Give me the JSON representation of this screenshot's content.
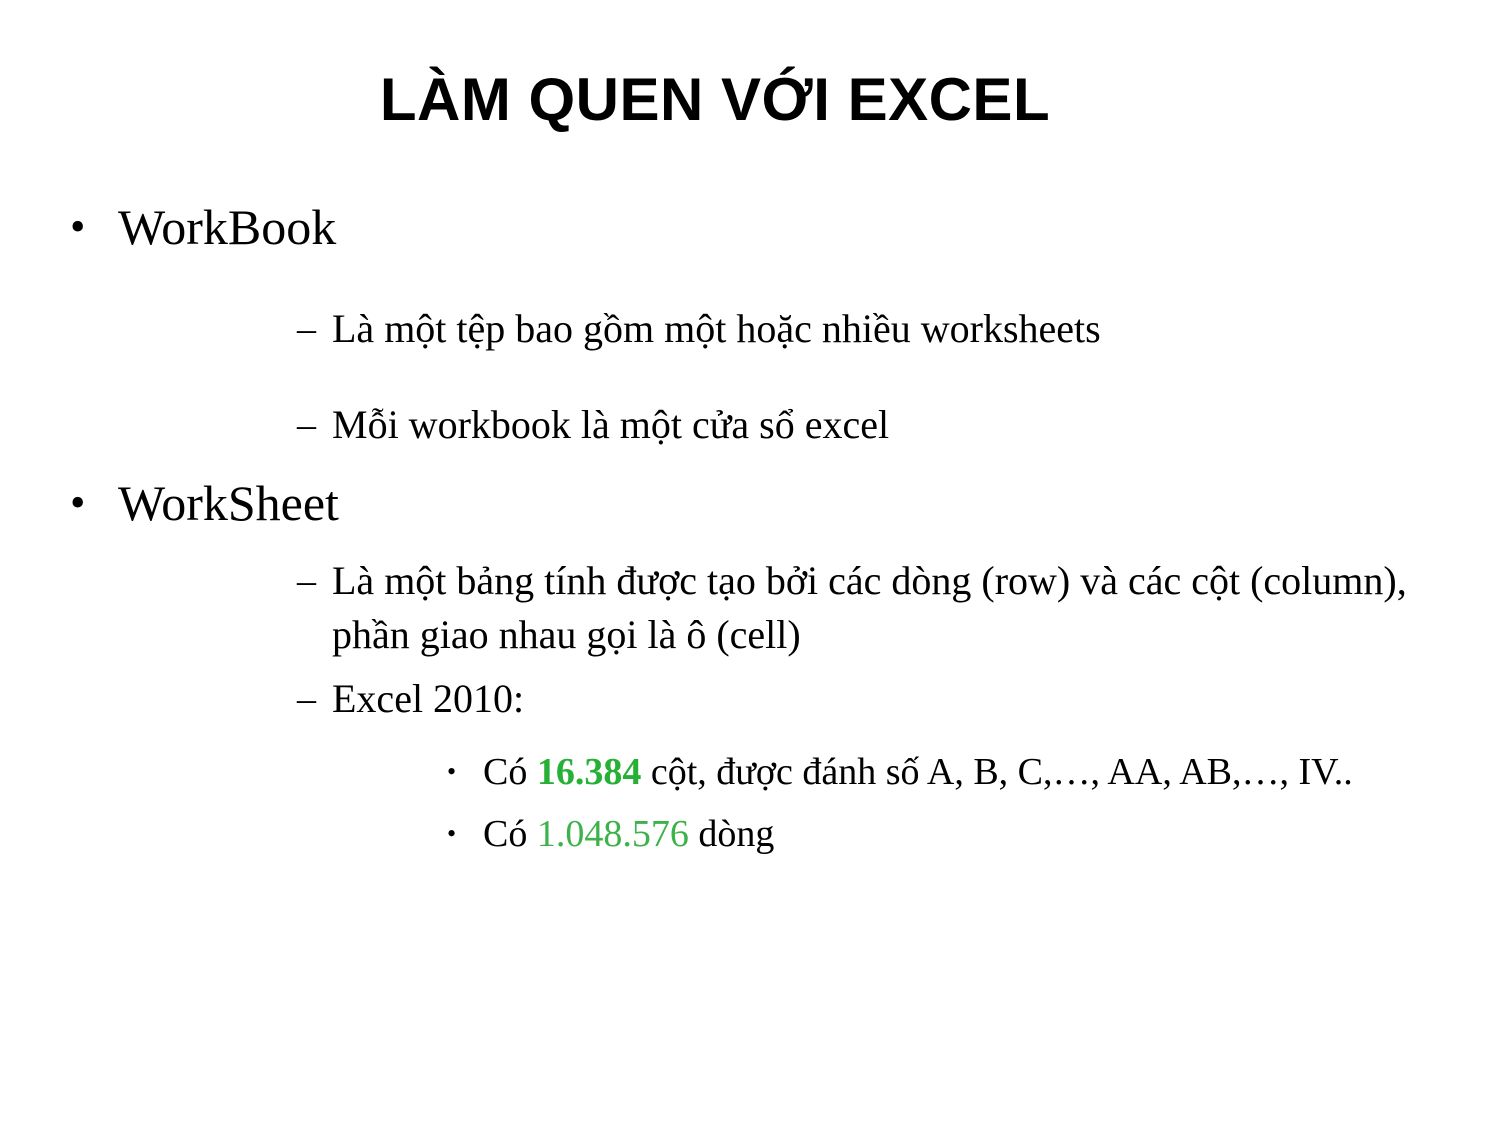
{
  "slide": {
    "title": "LÀM QUEN VỚI EXCEL",
    "bullet_glyph_level1": "•",
    "bullet_glyph_level2": "–",
    "bullet_glyph_level3": "•",
    "accent_green": "#27b036",
    "accent_green_light": "#3cb24a",
    "text_color": "#000000",
    "background_color": "#ffffff"
  },
  "content": {
    "workbook_heading": "WorkBook",
    "workbook_point_1": "Là một tệp bao gồm một hoặc nhiều worksheets",
    "workbook_point_2": "Mỗi workbook là một cửa sổ excel",
    "worksheet_heading": "WorkSheet",
    "worksheet_point_1": "Là một bảng tính được tạo bởi các dòng (row) và các cột (column), phần giao nhau gọi là ô (cell)",
    "worksheet_point_2": "Excel 2010:",
    "columns_prefix": "Có ",
    "columns_value": "16.384",
    "columns_suffix": " cột, được đánh số A, B, C,…, AA, AB,…, IV..",
    "rows_prefix": "Có ",
    "rows_value": "1.048.576",
    "rows_suffix": " dòng"
  }
}
